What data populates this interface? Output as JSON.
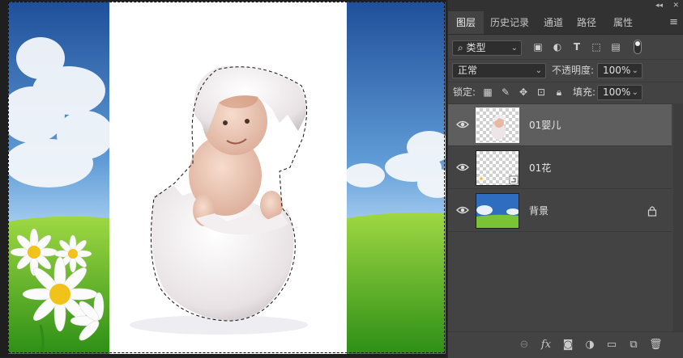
{
  "panel_tabs": [
    "图层",
    "历史记录",
    "通道",
    "路径",
    "属性"
  ],
  "topbar": {
    "collapse": "◂◂",
    "close": "✕"
  },
  "panel_menu_icon": "hamburger-menu-icon",
  "filter": {
    "label": "类型",
    "icons": [
      "image-filter-icon",
      "adjustment-filter-icon",
      "type-filter-icon",
      "shape-filter-icon",
      "smart-object-filter-icon"
    ]
  },
  "blend": {
    "mode": "正常",
    "opacity_label": "不透明度:",
    "opacity_value": "100%"
  },
  "lock": {
    "label": "锁定:",
    "fill_label": "填充:",
    "fill_value": "100%"
  },
  "layers": [
    {
      "name": "01婴儿",
      "visible": true,
      "selected": true,
      "locked": false
    },
    {
      "name": "01花",
      "visible": true,
      "selected": false,
      "locked": false,
      "smart_object": true
    },
    {
      "name": "背景",
      "visible": true,
      "selected": false,
      "locked": true
    }
  ],
  "bottom_icons": [
    "link-layers-icon",
    "fx-icon",
    "add-mask-icon",
    "adjustment-layer-icon",
    "new-group-icon",
    "new-layer-icon",
    "delete-layer-icon"
  ],
  "bottom_labels": {
    "fx": "fx"
  }
}
